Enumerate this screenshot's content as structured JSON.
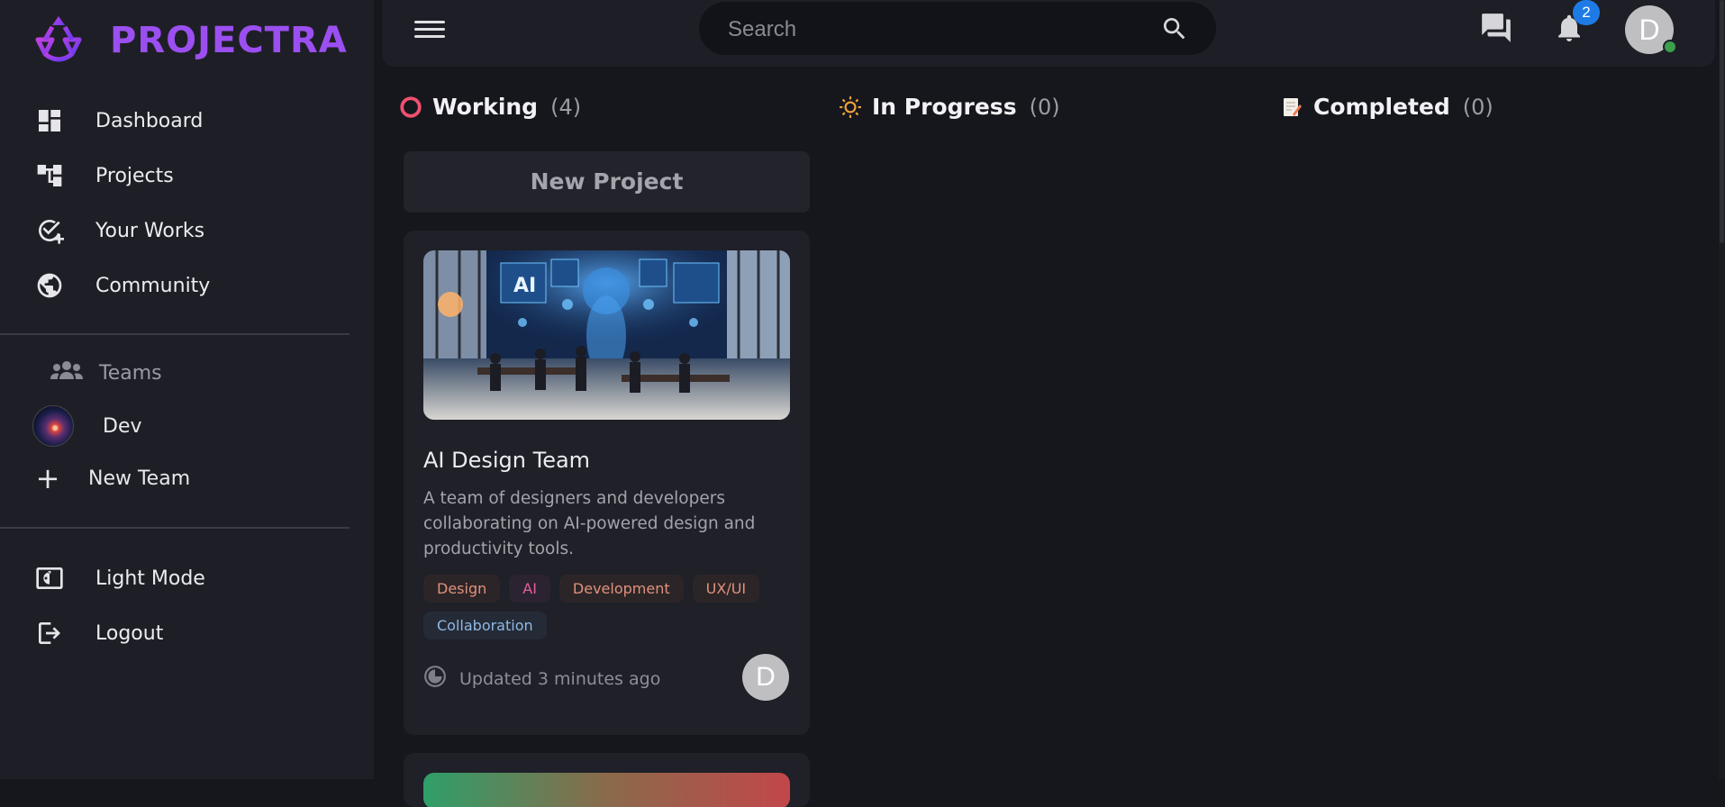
{
  "app": {
    "name": "PROJECTRA"
  },
  "sidebar": {
    "items": [
      {
        "label": "Dashboard",
        "icon": "dashboard-icon"
      },
      {
        "label": "Projects",
        "icon": "projects-icon"
      },
      {
        "label": "Your Works",
        "icon": "check-add-icon"
      },
      {
        "label": "Community",
        "icon": "globe-icon"
      }
    ],
    "teams_heading": "Teams",
    "teams": [
      {
        "label": "Dev"
      }
    ],
    "new_team_label": "New Team",
    "light_mode_label": "Light Mode",
    "logout_label": "Logout"
  },
  "topbar": {
    "search_placeholder": "Search",
    "notification_count": "2",
    "avatar_initial": "D"
  },
  "columns": [
    {
      "title": "Working",
      "count": "(4)",
      "icon": "circle-ring-icon",
      "color": "#f0506e"
    },
    {
      "title": "In Progress",
      "count": "(0)",
      "icon": "sun-icon",
      "color": "#f2a23a"
    },
    {
      "title": "Completed",
      "count": "(0)",
      "icon": "memo-icon",
      "color": "#f07a50"
    }
  ],
  "board": {
    "new_project_label": "New Project",
    "cards": [
      {
        "title": "AI Design Team",
        "description": "A team of designers and developers collaborating on AI-powered design and productivity tools.",
        "tags": [
          {
            "label": "Design",
            "bg": "#2c2528",
            "fg": "#e0917a"
          },
          {
            "label": "AI",
            "bg": "#2b2330",
            "fg": "#e0609a"
          },
          {
            "label": "Development",
            "bg": "#2c2528",
            "fg": "#e0917a"
          },
          {
            "label": "UX/UI",
            "bg": "#2c2528",
            "fg": "#e0917a"
          },
          {
            "label": "Collaboration",
            "bg": "#252b36",
            "fg": "#8fb8e6"
          }
        ],
        "updated": "Updated 3 minutes ago",
        "avatar_initial": "D"
      }
    ]
  },
  "colors": {
    "accent": "#9b4ff0",
    "badge": "#1e7be6",
    "online": "#3b9f4b"
  }
}
